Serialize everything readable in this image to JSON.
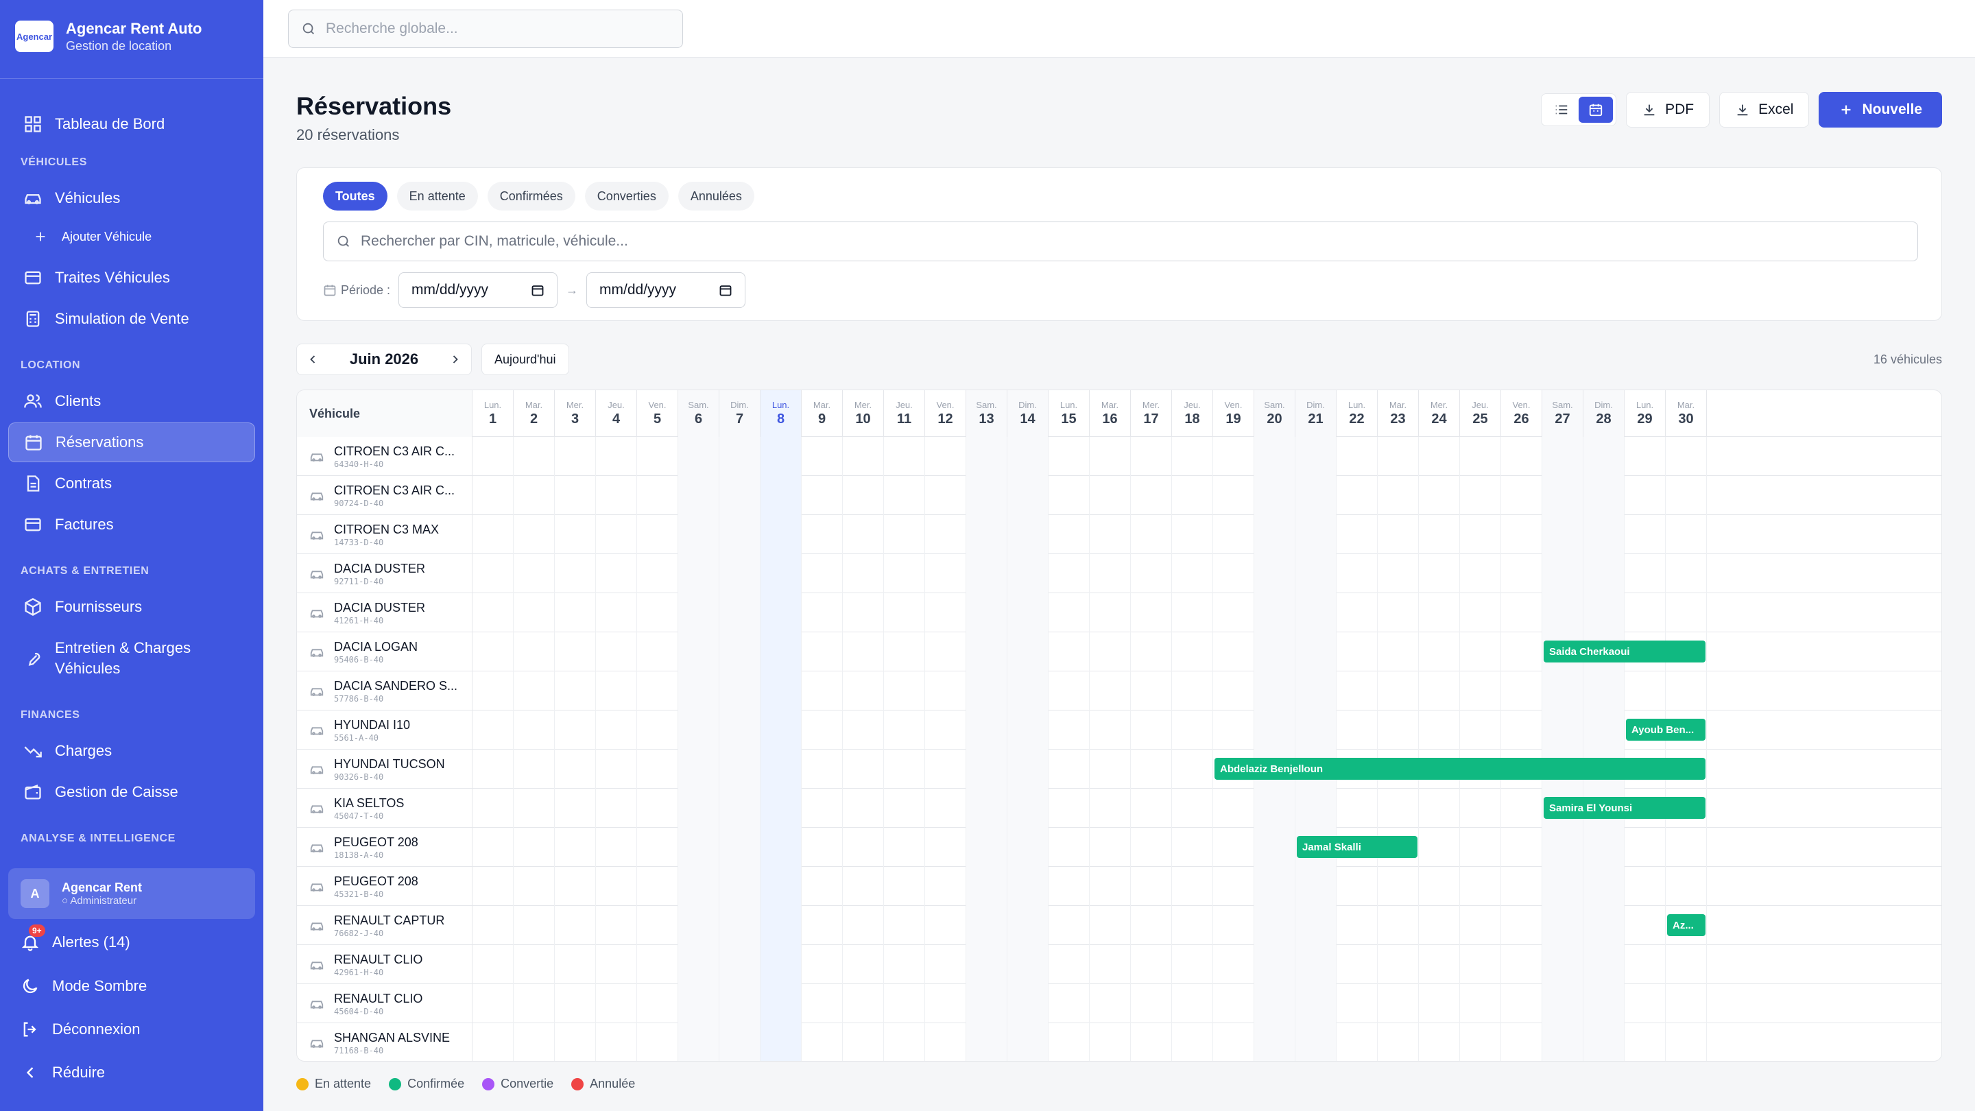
{
  "app": {
    "name": "Agencar Rent Auto",
    "subtitle": "Gestion de location",
    "logo_text": "Agencar"
  },
  "sidebar": {
    "dashboard": "Tableau de Bord",
    "sections": {
      "vehicules": "VÉHICULES",
      "location": "LOCATION",
      "achats": "ACHATS & ENTRETIEN",
      "finances": "FINANCES",
      "analyse": "ANALYSE & INTELLIGENCE"
    },
    "items": {
      "vehicules": "Véhicules",
      "ajouter_vehicule": "Ajouter Véhicule",
      "traites": "Traites Véhicules",
      "simulation": "Simulation de Vente",
      "clients": "Clients",
      "reservations": "Réservations",
      "contrats": "Contrats",
      "factures": "Factures",
      "fournisseurs": "Fournisseurs",
      "entretien_line1": "Entretien & Charges",
      "entretien_line2": "Véhicules",
      "charges": "Charges",
      "caisse": "Gestion de Caisse"
    },
    "user": {
      "initial": "A",
      "name": "Agencar Rent",
      "role": "Administrateur"
    },
    "alerts": {
      "label": "Alertes (14)",
      "badge": "9+"
    },
    "dark_mode": "Mode Sombre",
    "logout": "Déconnexion",
    "collapse": "Réduire"
  },
  "topbar": {
    "search_placeholder": "Recherche globale..."
  },
  "page": {
    "title": "Réservations",
    "count": "20 réservations"
  },
  "actions": {
    "pdf": "PDF",
    "excel": "Excel",
    "new": "Nouvelle"
  },
  "filters": {
    "tabs": [
      "Toutes",
      "En attente",
      "Confirmées",
      "Converties",
      "Annulées"
    ],
    "active_tab": 0,
    "search_placeholder": "Rechercher par CIN, matricule, véhicule...",
    "period_label": "Période :",
    "date_from": "mm/dd/yyyy",
    "date_to": "mm/dd/yyyy",
    "arrow": "→"
  },
  "calendar": {
    "month": "Juin 2026",
    "today_label": "Aujourd'hui",
    "vehicle_count": "16 véhicules",
    "vehicle_col": "Véhicule",
    "today": 8,
    "days": [
      {
        "n": "Lun.",
        "d": 1
      },
      {
        "n": "Mar.",
        "d": 2
      },
      {
        "n": "Mer.",
        "d": 3
      },
      {
        "n": "Jeu.",
        "d": 4
      },
      {
        "n": "Ven.",
        "d": 5
      },
      {
        "n": "Sam.",
        "d": 6
      },
      {
        "n": "Dim.",
        "d": 7
      },
      {
        "n": "Lun.",
        "d": 8
      },
      {
        "n": "Mar.",
        "d": 9
      },
      {
        "n": "Mer.",
        "d": 10
      },
      {
        "n": "Jeu.",
        "d": 11
      },
      {
        "n": "Ven.",
        "d": 12
      },
      {
        "n": "Sam.",
        "d": 13
      },
      {
        "n": "Dim.",
        "d": 14
      },
      {
        "n": "Lun.",
        "d": 15
      },
      {
        "n": "Mar.",
        "d": 16
      },
      {
        "n": "Mer.",
        "d": 17
      },
      {
        "n": "Jeu.",
        "d": 18
      },
      {
        "n": "Ven.",
        "d": 19
      },
      {
        "n": "Sam.",
        "d": 20
      },
      {
        "n": "Dim.",
        "d": 21
      },
      {
        "n": "Lun.",
        "d": 22
      },
      {
        "n": "Mar.",
        "d": 23
      },
      {
        "n": "Mer.",
        "d": 24
      },
      {
        "n": "Jeu.",
        "d": 25
      },
      {
        "n": "Ven.",
        "d": 26
      },
      {
        "n": "Sam.",
        "d": 27
      },
      {
        "n": "Dim.",
        "d": 28
      },
      {
        "n": "Lun.",
        "d": 29
      },
      {
        "n": "Mar.",
        "d": 30
      }
    ],
    "vehicles": [
      {
        "name": "CITROEN C3 AIR C...",
        "plate": "64340-H-40"
      },
      {
        "name": "CITROEN C3 AIR C...",
        "plate": "90724-D-40"
      },
      {
        "name": "CITROEN C3 MAX",
        "plate": "14733-D-40"
      },
      {
        "name": "DACIA DUSTER",
        "plate": "92711-D-40"
      },
      {
        "name": "DACIA DUSTER",
        "plate": "41261-H-40"
      },
      {
        "name": "DACIA LOGAN",
        "plate": "95406-B-40"
      },
      {
        "name": "DACIA SANDERO S...",
        "plate": "57786-B-40"
      },
      {
        "name": "HYUNDAI I10",
        "plate": "5561-A-40"
      },
      {
        "name": "HYUNDAI TUCSON",
        "plate": "90326-B-40"
      },
      {
        "name": "KIA SELTOS",
        "plate": "45047-T-40"
      },
      {
        "name": "PEUGEOT 208",
        "plate": "18138-A-40"
      },
      {
        "name": "PEUGEOT 208",
        "plate": "45321-B-40"
      },
      {
        "name": "RENAULT CAPTUR",
        "plate": "76682-J-40"
      },
      {
        "name": "RENAULT CLIO",
        "plate": "42961-H-40"
      },
      {
        "name": "RENAULT CLIO",
        "plate": "45604-D-40"
      },
      {
        "name": "SHANGAN ALSVINE",
        "plate": "71168-B-40"
      }
    ],
    "reservations": [
      {
        "vehicle": 5,
        "start": 27,
        "end": 30,
        "label": "Saida Cherkaoui",
        "status": "confirmee"
      },
      {
        "vehicle": 7,
        "start": 29,
        "end": 30,
        "label": "Ayoub Ben...",
        "status": "confirmee"
      },
      {
        "vehicle": 8,
        "start": 19,
        "end": 30,
        "label": "Abdelaziz Benjelloun",
        "status": "confirmee"
      },
      {
        "vehicle": 9,
        "start": 27,
        "end": 30,
        "label": "Samira El Younsi",
        "status": "confirmee"
      },
      {
        "vehicle": 10,
        "start": 21,
        "end": 23,
        "label": "Jamal Skalli",
        "status": "confirmee"
      },
      {
        "vehicle": 12,
        "start": 30,
        "end": 30,
        "label": "Az...",
        "status": "confirmee"
      }
    ]
  },
  "legend": [
    {
      "label": "En attente",
      "color": "#f5b715"
    },
    {
      "label": "Confirmée",
      "color": "#10b981"
    },
    {
      "label": "Convertie",
      "color": "#a855f7"
    },
    {
      "label": "Annulée",
      "color": "#ef4444"
    }
  ]
}
